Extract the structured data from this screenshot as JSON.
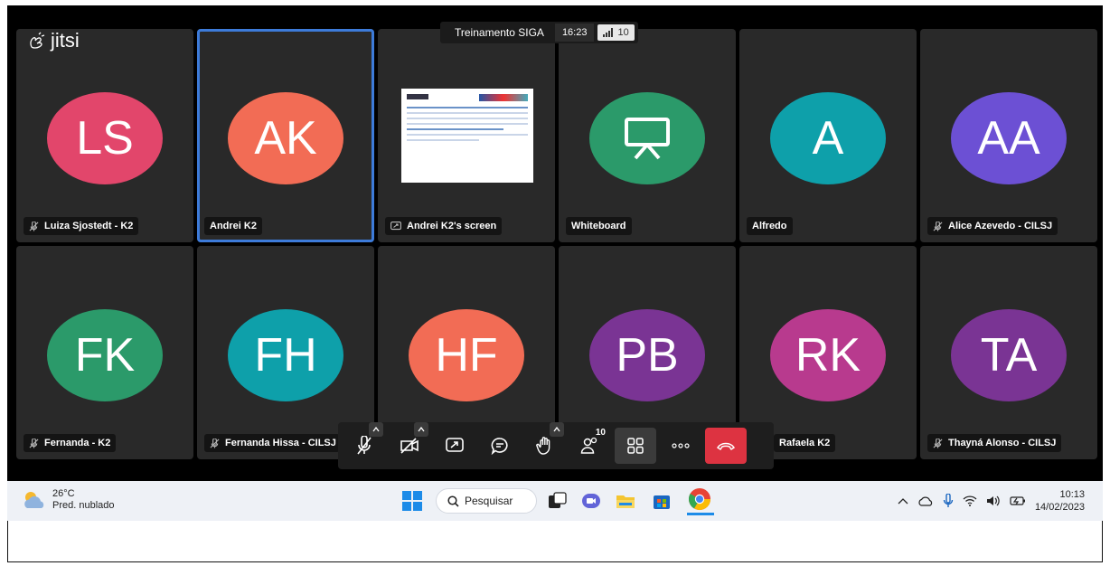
{
  "app": {
    "logo_text": "jitsi",
    "meeting_title": "Treinamento SIGA",
    "meeting_time": "16:23",
    "participant_count": "10"
  },
  "tiles": [
    {
      "initials": "LS",
      "name": "Luiza Sjostedt - K2",
      "color": "#e2466b",
      "muted": true
    },
    {
      "initials": "AK",
      "name": "Andrei K2",
      "color": "#f26c55",
      "muted": false,
      "active": true
    },
    {
      "initials": "",
      "name": "Andrei K2's screen",
      "color": "#292929",
      "muted": false,
      "screen": true
    },
    {
      "initials": "",
      "name": "Whiteboard",
      "color": "#2b9a6a",
      "muted": false,
      "whiteboard": true
    },
    {
      "initials": "A",
      "name": "Alfredo",
      "color": "#0ea0aa",
      "muted": false
    },
    {
      "initials": "AA",
      "name": "Alice Azevedo - CILSJ",
      "color": "#6c50d4",
      "muted": true
    },
    {
      "initials": "FK",
      "name": "Fernanda - K2",
      "color": "#2b9a6a",
      "muted": true
    },
    {
      "initials": "FH",
      "name": "Fernanda Hissa - CILSJ",
      "color": "#0ea0aa",
      "muted": true
    },
    {
      "initials": "HF",
      "name": "",
      "color": "#f26c55",
      "muted": false
    },
    {
      "initials": "PB",
      "name": "",
      "color": "#7a3494",
      "muted": false
    },
    {
      "initials": "RK",
      "name": "Rafaela K2",
      "color": "#b83a8e",
      "muted": false
    },
    {
      "initials": "TA",
      "name": "Thayná Alonso - CILSJ",
      "color": "#7a3494",
      "muted": true
    }
  ],
  "toolbar": {
    "participants_badge": "10"
  },
  "taskbar": {
    "temperature": "26°C",
    "weather_desc": "Pred. nublado",
    "search_label": "Pesquisar",
    "time": "10:13",
    "date": "14/02/2023"
  }
}
